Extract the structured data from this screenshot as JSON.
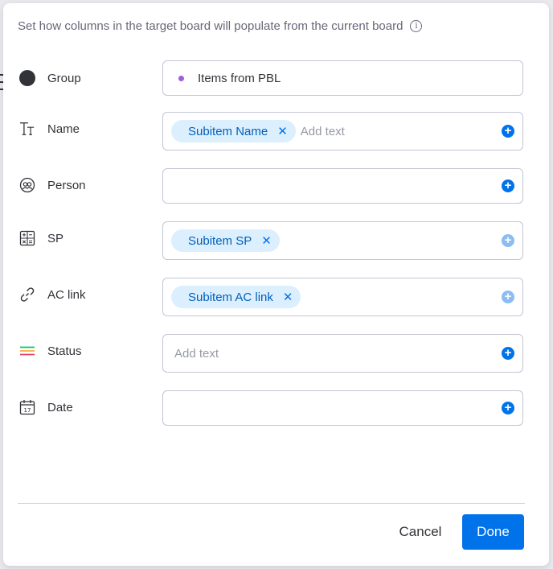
{
  "dialog": {
    "subtitle": "Set how columns in the target board will populate from the current board",
    "info_icon": "info-icon"
  },
  "rows": {
    "group": {
      "label": "Group",
      "icon": "group-circle-icon",
      "value": "Items from PBL",
      "dot_color": "#a25ddc"
    },
    "name": {
      "label": "Name",
      "icon": "text-type-icon",
      "chip": "Subitem Name",
      "placeholder": "Add text"
    },
    "person": {
      "label": "Person",
      "icon": "person-icon"
    },
    "sp": {
      "label": "SP",
      "icon": "numbers-calculator-icon",
      "chip": "Subitem SP"
    },
    "ac_link": {
      "label": "AC link",
      "icon": "link-icon",
      "chip": "Subitem AC link"
    },
    "status": {
      "label": "Status",
      "icon": "status-lines-icon",
      "placeholder": "Add text"
    },
    "date": {
      "label": "Date",
      "icon": "calendar-icon"
    }
  },
  "footer": {
    "cancel_label": "Cancel",
    "done_label": "Done"
  },
  "colors": {
    "primary": "#0073ea",
    "chip_bg": "#dcefff",
    "chip_text": "#0060b9"
  }
}
